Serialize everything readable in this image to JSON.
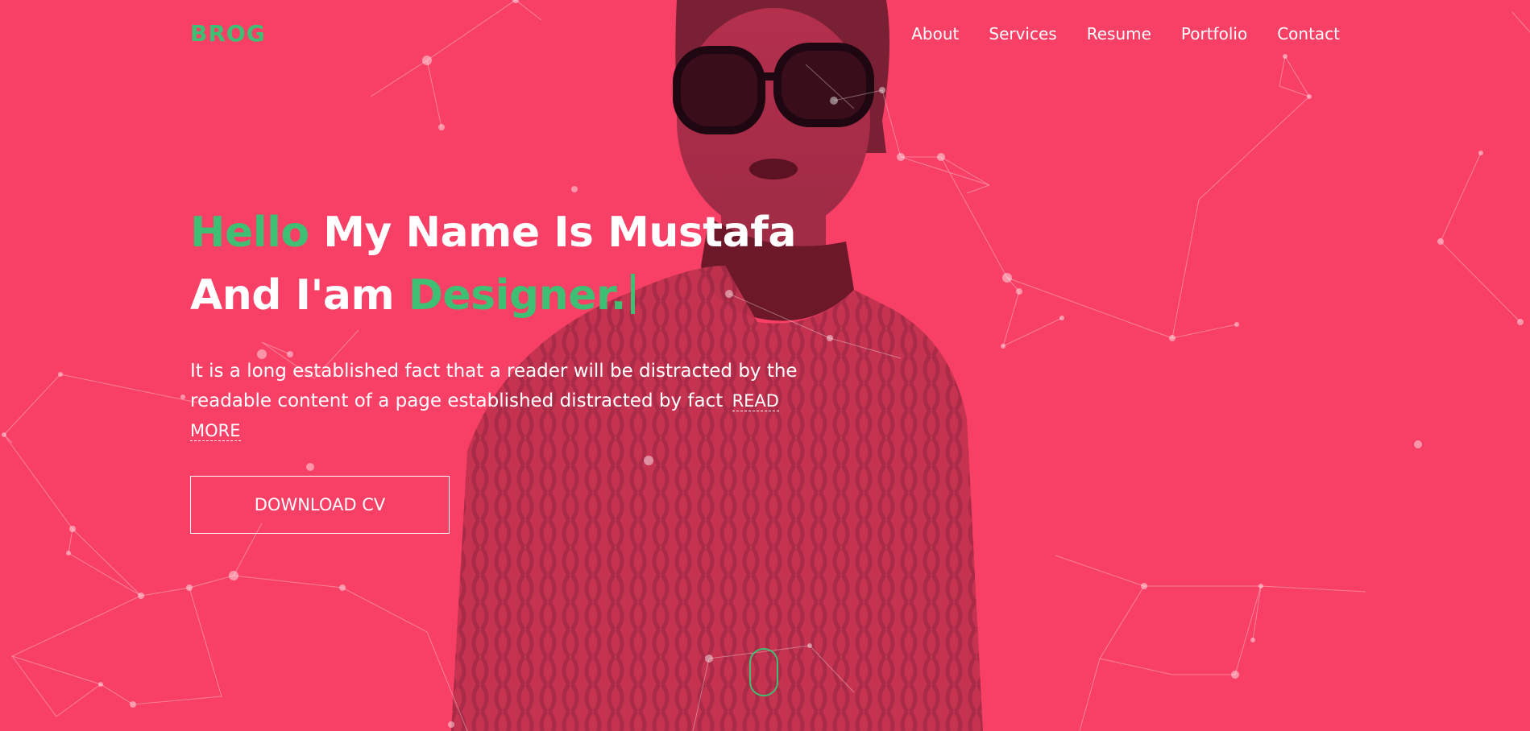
{
  "brand": {
    "logo": "BROG",
    "accent_color": "#3ebf73",
    "background_color": "#f83f65"
  },
  "nav": {
    "items": [
      {
        "label": "About"
      },
      {
        "label": "Services"
      },
      {
        "label": "Resume"
      },
      {
        "label": "Portfolio"
      },
      {
        "label": "Contact"
      }
    ]
  },
  "hero": {
    "greeting": "Hello",
    "headline_rest": "My Name Is Mustafa",
    "line2_prefix": "And I'am",
    "role": "Designer.",
    "description": "It is a long established fact that a reader will be distracted by the readable content of a page established distracted by fact",
    "read_more": "READ MORE",
    "download_label": "DOWNLOAD CV"
  },
  "icons": {
    "scroll": "mouse-scroll-icon"
  }
}
